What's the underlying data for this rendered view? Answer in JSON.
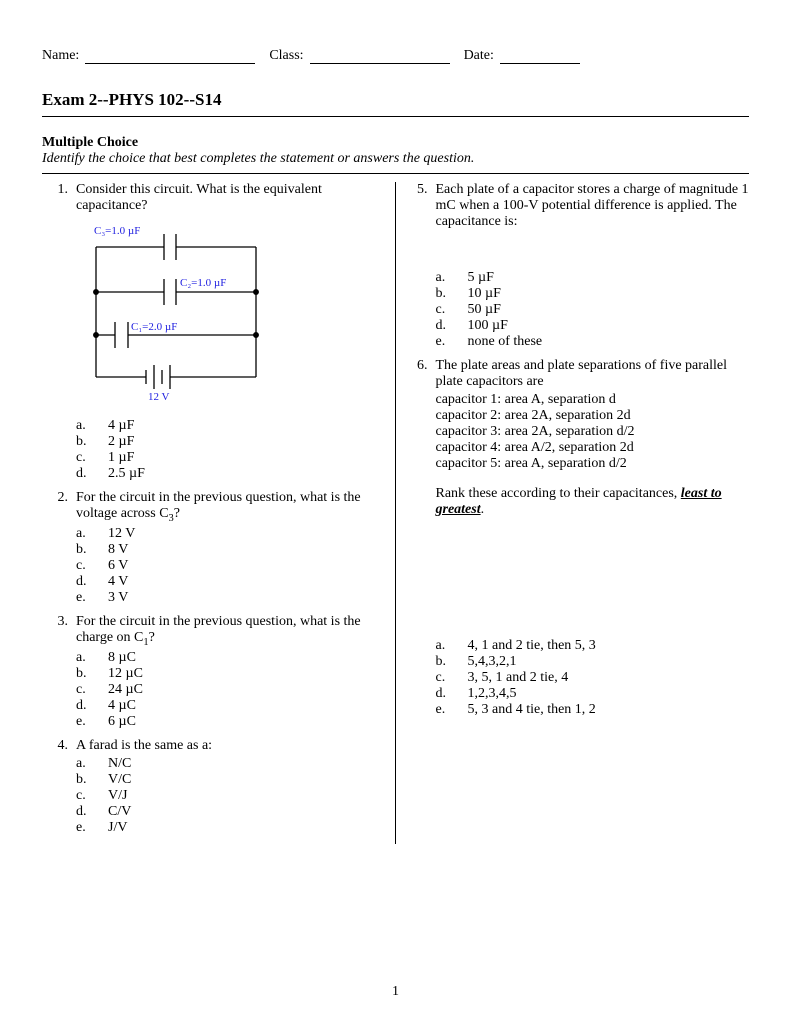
{
  "header": {
    "name_label": "Name:",
    "class_label": "Class:",
    "date_label": "Date:"
  },
  "title": "Exam 2--PHYS 102--S14",
  "section": {
    "label": "Multiple Choice",
    "instructions": "Identify the choice that best completes the statement or answers the question."
  },
  "circuit": {
    "c3": "C₃=1.0 µF",
    "c2": "C₂=1.0 µF",
    "c1": "C₁=2.0 µF",
    "voltage": "12 V"
  },
  "q1": {
    "num": "1.",
    "text": "Consider this circuit.  What is the equivalent capacitance?",
    "a": "a.",
    "a_text": "4 µF",
    "b": "b.",
    "b_text": "2 µF",
    "c": "c.",
    "c_text": "1 µF",
    "d": "d.",
    "d_text": "2.5 µF"
  },
  "q2": {
    "num": "2.",
    "text_pre": "For the circuit in the previous question, what is the voltage across C",
    "text_sub": "3",
    "text_post": "?",
    "a": "a.",
    "a_text": "12 V",
    "b": "b.",
    "b_text": "8 V",
    "c": "c.",
    "c_text": "6 V",
    "d": "d.",
    "d_text": "4 V",
    "e": "e.",
    "e_text": "3 V"
  },
  "q3": {
    "num": "3.",
    "text_pre": "For the circuit in the previous question, what is the charge on C",
    "text_sub": "1",
    "text_post": "?",
    "a": "a.",
    "a_text": "8 µC",
    "b": "b.",
    "b_text": "12 µC",
    "c": "c.",
    "c_text": "24 µC",
    "d": "d.",
    "d_text": "4 µC",
    "e": "e.",
    "e_text": "6 µC"
  },
  "q4": {
    "num": "4.",
    "text": "A farad is the same as a:",
    "a": "a.",
    "a_text": "N/C",
    "b": "b.",
    "b_text": "V/C",
    "c": "c.",
    "c_text": "V/J",
    "d": "d.",
    "d_text": "C/V",
    "e": "e.",
    "e_text": "J/V"
  },
  "q5": {
    "num": "5.",
    "text": "Each plate of a capacitor stores a charge of magnitude 1 mC when a 100-V potential difference is applied. The capacitance is:",
    "a": "a.",
    "a_text": "5 µF",
    "b": "b.",
    "b_text": "10 µF",
    "c": "c.",
    "c_text": "50 µF",
    "d": "d.",
    "d_text": "100 µF",
    "e": "e.",
    "e_text": "none of these"
  },
  "q6": {
    "num": "6.",
    "text": "The plate areas and plate separations of five parallel plate capacitors are",
    "cap1": "capacitor 1: area A, separation d",
    "cap2": "capacitor 2: area 2A, separation 2d",
    "cap3": "capacitor 3: area 2A, separation d/2",
    "cap4": "capacitor 4: area A/2, separation 2d",
    "cap5": "capacitor 5: area A, separation d/2",
    "rank_pre": "Rank these according to their capacitances, ",
    "rank_emph": "least to greatest",
    "rank_post": ".",
    "a": "a.",
    "a_text": "4, 1 and 2 tie, then 5, 3",
    "b": "b.",
    "b_text": "5,4,3,2,1",
    "c": "c.",
    "c_text": "3, 5, 1 and 2 tie, 4",
    "d": "d.",
    "d_text": "1,2,3,4,5",
    "e": "e.",
    "e_text": "5, 3 and 4 tie, then 1, 2"
  },
  "page_number": "1"
}
